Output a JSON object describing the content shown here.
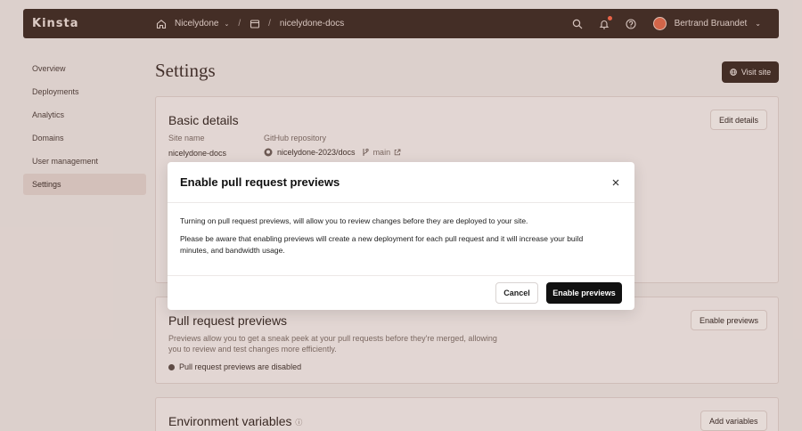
{
  "topbar": {
    "logo": "Kinsta",
    "company": "Nicelydone",
    "site": "nicelydone-docs",
    "user_name": "Bertrand Bruandet"
  },
  "sidebar": {
    "items": [
      {
        "label": "Overview"
      },
      {
        "label": "Deployments"
      },
      {
        "label": "Analytics"
      },
      {
        "label": "Domains"
      },
      {
        "label": "User management"
      },
      {
        "label": "Settings"
      }
    ],
    "active": "Settings"
  },
  "page": {
    "title": "Settings",
    "visit_site_label": "Visit site"
  },
  "basic_details": {
    "heading": "Basic details",
    "edit_label": "Edit details",
    "site_name_label": "Site name",
    "site_name_value": "nicelydone-docs",
    "repo_label": "GitHub repository",
    "repo_value": "nicelydone-2023/docs",
    "branch_value": "main"
  },
  "pull_request_previews": {
    "heading": "Pull request previews",
    "enable_label": "Enable previews",
    "description": "Previews allow you to get a sneak peek at your pull requests before they're merged, allowing you to review and test changes more efficiently.",
    "status": "Pull request previews are disabled"
  },
  "environment_variables": {
    "heading": "Environment variables",
    "add_label": "Add variables"
  },
  "modal": {
    "title": "Enable pull request previews",
    "paragraph_1": "Turning on pull request previews, will allow you to review changes before they are deployed to your site.",
    "paragraph_2": "Please be aware that enabling previews will create a new deployment for each pull request and it will increase your build minutes, and bandwidth usage.",
    "cancel_label": "Cancel",
    "confirm_label": "Enable previews"
  }
}
